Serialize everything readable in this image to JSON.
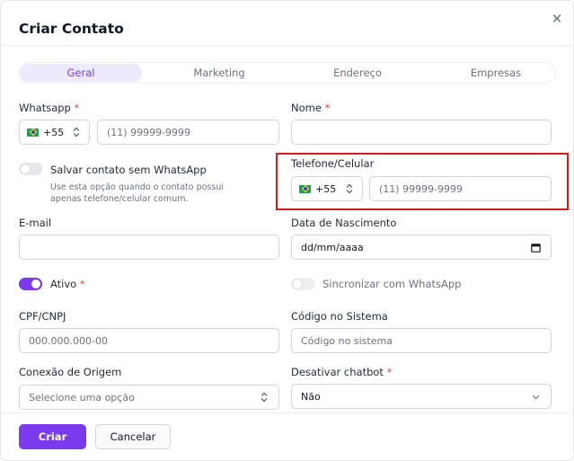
{
  "dialog": {
    "title": "Criar Contato",
    "close_glyph": "✕"
  },
  "tabs": [
    {
      "label": "Geral",
      "active": true
    },
    {
      "label": "Marketing",
      "active": false
    },
    {
      "label": "Endereço",
      "active": false
    },
    {
      "label": "Empresas",
      "active": false
    }
  ],
  "fields": {
    "whatsapp": {
      "label": "Whatsapp",
      "required_mark": "*",
      "country_code": "+55",
      "placeholder": "(11) 99999-9999"
    },
    "nome": {
      "label": "Nome",
      "required_mark": "*",
      "value": ""
    },
    "salvar_sem_whatsapp": {
      "label": "Salvar contato sem WhatsApp",
      "hint": "Use esta opção quando o contato possui apenas telefone/celular comum.",
      "on": false
    },
    "telefone": {
      "label": "Telefone/Celular",
      "country_code": "+55",
      "placeholder": "(11) 99999-9999"
    },
    "email": {
      "label": "E-mail",
      "value": ""
    },
    "nascimento": {
      "label": "Data de Nascimento",
      "placeholder": "dd/mm/aaaa"
    },
    "ativo": {
      "label": "Ativo",
      "required_mark": "*",
      "on": true
    },
    "sincronizar": {
      "label": "Sincronizar com WhatsApp",
      "on": false
    },
    "cpf": {
      "label": "CPF/CNPJ",
      "placeholder": "000.000.000-00"
    },
    "codigo": {
      "label": "Código no Sistema",
      "placeholder": "Código no sistema"
    },
    "conexao": {
      "label": "Conexão de Origem",
      "placeholder": "Selecione uma opção"
    },
    "chatbot": {
      "label": "Desativar chatbot",
      "required_mark": "*",
      "value": "Não"
    }
  },
  "footer": {
    "create_label": "Criar",
    "cancel_label": "Cancelar"
  },
  "colors": {
    "accent": "#7c3aed",
    "accent_soft": "#ede9fe",
    "required": "#ef4444",
    "highlight": "#d21c1c"
  },
  "icons": {
    "close": "close-icon",
    "flag": "brazil-flag-icon",
    "select": "updown-chevron-icon",
    "dropdown": "chevron-down-icon",
    "calendar": "calendar-icon"
  }
}
